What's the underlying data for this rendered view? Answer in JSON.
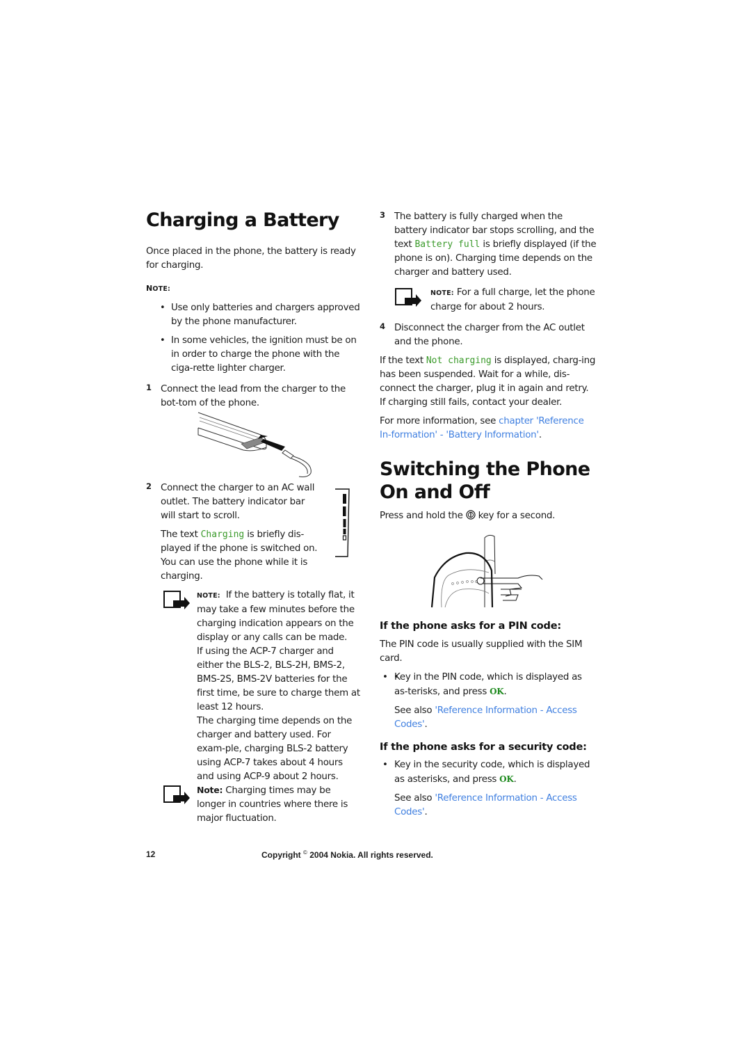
{
  "left_column": {
    "title": "Charging a Battery",
    "intro": "Once placed in the phone, the battery is ready for charging.",
    "note_label_1": "N",
    "note_label_1_rest": "OTE:",
    "bullets": [
      "Use only batteries and chargers approved by the phone manufacturer.",
      "In some vehicles, the ignition must be on in order to charge the phone with the ciga-rette lighter charger."
    ],
    "step1": {
      "number": "1",
      "text": "Connect the lead from the charger to the bot-tom of the phone."
    },
    "step2": {
      "number": "2",
      "text": "Connect the charger to an AC wall outlet. The battery indicator bar will start to scroll.",
      "text2_before": "The text ",
      "text2_mono": "Charging",
      "text2_after": " is briefly dis-played if the phone is switched on. You can use the phone while it is charging."
    },
    "note2": {
      "label": "NOTE:",
      "text": "If the battery is totally flat, it may take a few minutes before the charging indication appears on the display or any calls can be made.",
      "text_b": "If using the ACP-7 charger and either the BLS-2, BLS-2H, BMS-2, BMS-2S, BMS-2V batteries for the first time, be sure to charge them at least 12 hours.",
      "text_c": "The charging time depends on the charger and battery used. For exam-ple, charging BLS-2 battery using ACP-7 takes about 4 hours and using ACP-9 about 2 hours."
    },
    "note3": {
      "label": "Note:",
      "text": "Charging times may be longer in countries where there is major fluctuation."
    }
  },
  "right_column": {
    "step3": {
      "number": "3",
      "text_before": "The battery is fully charged when the battery indicator bar stops scrolling, and the text ",
      "mono": "Battery full",
      "text_after": " is briefly displayed (if the phone is on). Charging time depends on the charger and battery used."
    },
    "note_full": {
      "label": "NOTE:",
      "text": "For a full charge, let the phone charge for about 2 hours."
    },
    "step4": {
      "number": "4",
      "text": "Disconnect the charger from the AC outlet and the phone."
    },
    "not_charging": {
      "before": "If the text ",
      "mono": "Not charging",
      "after": " is displayed, charg-ing has been suspended. Wait for a while, dis-connect the charger, plug it in again and retry. If charging still fails, contact your dealer."
    },
    "more_info": {
      "before": "For more information, see ",
      "link": "chapter 'Reference In-formation' - 'Battery Information'",
      "after": "."
    },
    "title2": "Switching the Phone On and Off",
    "press_before": "Press and hold the ",
    "press_after": " key for a second.",
    "pin": {
      "heading": "If the phone asks for a PIN code:",
      "intro": "The PIN code is usually supplied with the SIM card.",
      "bullet_before": "Key in the PIN code, which is displayed as as-terisks, and press ",
      "ok": "OK",
      "bullet_after": ".",
      "see_before": "See also ",
      "see_link": "'Reference Information - Access Codes'",
      "see_after": "."
    },
    "security": {
      "heading": "If the phone asks for a security code:",
      "bullet_before": "Key in the security code, which is displayed as asterisks, and press ",
      "ok": "OK",
      "bullet_after": ".",
      "see_before": "See also ",
      "see_link": "'Reference Information - Access Codes'",
      "see_after": "."
    }
  },
  "footer": {
    "page_number": "12",
    "copyright_before": "Copyright ",
    "copyright_symbol": "©",
    "copyright_after": " 2004 Nokia. All rights reserved."
  },
  "colors": {
    "link": "#3f7fe0",
    "mono_text": "#3a9a2a",
    "ok_key": "#1e8a1e"
  }
}
